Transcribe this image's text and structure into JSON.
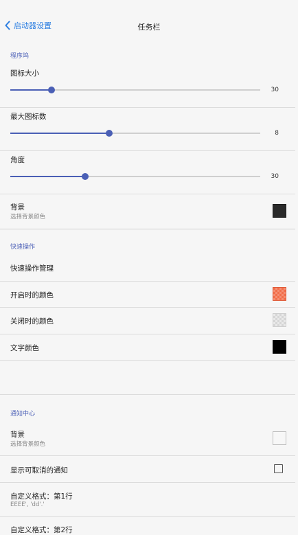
{
  "header": {
    "back_label": "启动器设置",
    "title": "任务栏"
  },
  "dock": {
    "section_title": "程序坞",
    "icon_size": {
      "label": "图标大小",
      "value": "30",
      "fraction": 0.165
    },
    "max_icons": {
      "label": "最大图标数",
      "value": "8",
      "fraction": 0.396
    },
    "angle": {
      "label": "角度",
      "value": "30",
      "fraction": 0.3
    },
    "background": {
      "label": "背景",
      "sub": "选择背景颜色",
      "color": "#2a2a2a"
    }
  },
  "quick_actions": {
    "section_title": "快速操作",
    "manage_label": "快速操作管理",
    "on_color": {
      "label": "开启时的颜色",
      "color": "#f26f4b"
    },
    "off_color": {
      "label": "关闭时的颜色",
      "color": "#e3e3e3"
    },
    "text_color": {
      "label": "文字颜色",
      "color": "#000000"
    }
  },
  "notification_center": {
    "section_title": "通知中心",
    "background": {
      "label": "背景",
      "sub": "选择背景颜色",
      "color": "#f7f7f7"
    },
    "show_dismissable": {
      "label": "显示可取消的通知",
      "checked": false
    },
    "custom_format_1": {
      "label": "自定义格式：第1行",
      "sub": "EEEE', 'dd'.'"
    },
    "custom_format_2": {
      "label": "自定义格式：第2行"
    }
  },
  "colors": {
    "accent": "#4a5fb5",
    "link": "#2a7de1"
  }
}
